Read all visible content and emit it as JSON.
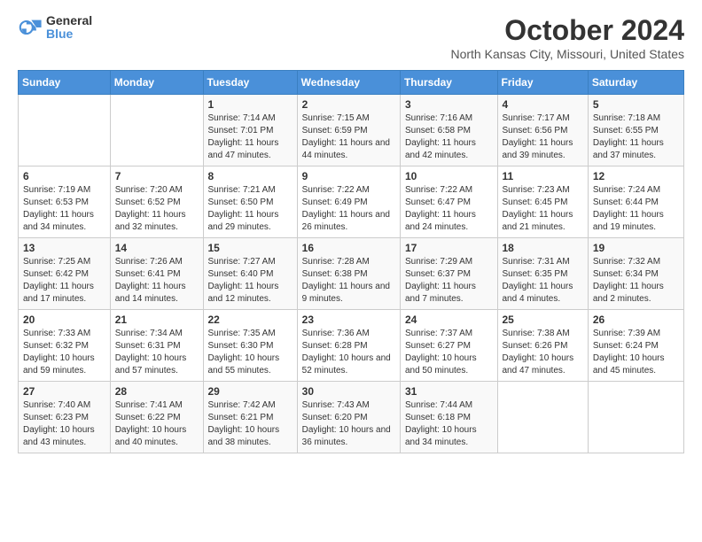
{
  "logo": {
    "general": "General",
    "blue": "Blue"
  },
  "title": "October 2024",
  "subtitle": "North Kansas City, Missouri, United States",
  "days_of_week": [
    "Sunday",
    "Monday",
    "Tuesday",
    "Wednesday",
    "Thursday",
    "Friday",
    "Saturday"
  ],
  "weeks": [
    [
      {
        "day": "",
        "info": ""
      },
      {
        "day": "",
        "info": ""
      },
      {
        "day": "1",
        "info": "Sunrise: 7:14 AM\nSunset: 7:01 PM\nDaylight: 11 hours and 47 minutes."
      },
      {
        "day": "2",
        "info": "Sunrise: 7:15 AM\nSunset: 6:59 PM\nDaylight: 11 hours and 44 minutes."
      },
      {
        "day": "3",
        "info": "Sunrise: 7:16 AM\nSunset: 6:58 PM\nDaylight: 11 hours and 42 minutes."
      },
      {
        "day": "4",
        "info": "Sunrise: 7:17 AM\nSunset: 6:56 PM\nDaylight: 11 hours and 39 minutes."
      },
      {
        "day": "5",
        "info": "Sunrise: 7:18 AM\nSunset: 6:55 PM\nDaylight: 11 hours and 37 minutes."
      }
    ],
    [
      {
        "day": "6",
        "info": "Sunrise: 7:19 AM\nSunset: 6:53 PM\nDaylight: 11 hours and 34 minutes."
      },
      {
        "day": "7",
        "info": "Sunrise: 7:20 AM\nSunset: 6:52 PM\nDaylight: 11 hours and 32 minutes."
      },
      {
        "day": "8",
        "info": "Sunrise: 7:21 AM\nSunset: 6:50 PM\nDaylight: 11 hours and 29 minutes."
      },
      {
        "day": "9",
        "info": "Sunrise: 7:22 AM\nSunset: 6:49 PM\nDaylight: 11 hours and 26 minutes."
      },
      {
        "day": "10",
        "info": "Sunrise: 7:22 AM\nSunset: 6:47 PM\nDaylight: 11 hours and 24 minutes."
      },
      {
        "day": "11",
        "info": "Sunrise: 7:23 AM\nSunset: 6:45 PM\nDaylight: 11 hours and 21 minutes."
      },
      {
        "day": "12",
        "info": "Sunrise: 7:24 AM\nSunset: 6:44 PM\nDaylight: 11 hours and 19 minutes."
      }
    ],
    [
      {
        "day": "13",
        "info": "Sunrise: 7:25 AM\nSunset: 6:42 PM\nDaylight: 11 hours and 17 minutes."
      },
      {
        "day": "14",
        "info": "Sunrise: 7:26 AM\nSunset: 6:41 PM\nDaylight: 11 hours and 14 minutes."
      },
      {
        "day": "15",
        "info": "Sunrise: 7:27 AM\nSunset: 6:40 PM\nDaylight: 11 hours and 12 minutes."
      },
      {
        "day": "16",
        "info": "Sunrise: 7:28 AM\nSunset: 6:38 PM\nDaylight: 11 hours and 9 minutes."
      },
      {
        "day": "17",
        "info": "Sunrise: 7:29 AM\nSunset: 6:37 PM\nDaylight: 11 hours and 7 minutes."
      },
      {
        "day": "18",
        "info": "Sunrise: 7:31 AM\nSunset: 6:35 PM\nDaylight: 11 hours and 4 minutes."
      },
      {
        "day": "19",
        "info": "Sunrise: 7:32 AM\nSunset: 6:34 PM\nDaylight: 11 hours and 2 minutes."
      }
    ],
    [
      {
        "day": "20",
        "info": "Sunrise: 7:33 AM\nSunset: 6:32 PM\nDaylight: 10 hours and 59 minutes."
      },
      {
        "day": "21",
        "info": "Sunrise: 7:34 AM\nSunset: 6:31 PM\nDaylight: 10 hours and 57 minutes."
      },
      {
        "day": "22",
        "info": "Sunrise: 7:35 AM\nSunset: 6:30 PM\nDaylight: 10 hours and 55 minutes."
      },
      {
        "day": "23",
        "info": "Sunrise: 7:36 AM\nSunset: 6:28 PM\nDaylight: 10 hours and 52 minutes."
      },
      {
        "day": "24",
        "info": "Sunrise: 7:37 AM\nSunset: 6:27 PM\nDaylight: 10 hours and 50 minutes."
      },
      {
        "day": "25",
        "info": "Sunrise: 7:38 AM\nSunset: 6:26 PM\nDaylight: 10 hours and 47 minutes."
      },
      {
        "day": "26",
        "info": "Sunrise: 7:39 AM\nSunset: 6:24 PM\nDaylight: 10 hours and 45 minutes."
      }
    ],
    [
      {
        "day": "27",
        "info": "Sunrise: 7:40 AM\nSunset: 6:23 PM\nDaylight: 10 hours and 43 minutes."
      },
      {
        "day": "28",
        "info": "Sunrise: 7:41 AM\nSunset: 6:22 PM\nDaylight: 10 hours and 40 minutes."
      },
      {
        "day": "29",
        "info": "Sunrise: 7:42 AM\nSunset: 6:21 PM\nDaylight: 10 hours and 38 minutes."
      },
      {
        "day": "30",
        "info": "Sunrise: 7:43 AM\nSunset: 6:20 PM\nDaylight: 10 hours and 36 minutes."
      },
      {
        "day": "31",
        "info": "Sunrise: 7:44 AM\nSunset: 6:18 PM\nDaylight: 10 hours and 34 minutes."
      },
      {
        "day": "",
        "info": ""
      },
      {
        "day": "",
        "info": ""
      }
    ]
  ]
}
